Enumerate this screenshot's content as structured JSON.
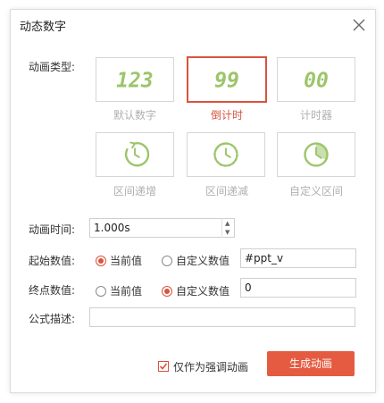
{
  "dialog": {
    "title": "动态数字",
    "animation_type_label": "动画类型:",
    "types": [
      {
        "display": "123",
        "label": "默认数字",
        "selected": false,
        "icon": "digits"
      },
      {
        "display": "99",
        "label": "倒计时",
        "selected": true,
        "icon": "digits"
      },
      {
        "display": "00",
        "label": "计时器",
        "selected": false,
        "icon": "digits"
      },
      {
        "display": "",
        "label": "区间递增",
        "selected": false,
        "icon": "clock-increase-icon"
      },
      {
        "display": "",
        "label": "区间递减",
        "selected": false,
        "icon": "clock-decrease-icon"
      },
      {
        "display": "",
        "label": "自定义区间",
        "selected": false,
        "icon": "clock-custom-icon"
      }
    ],
    "duration": {
      "label": "动画时间:",
      "value": "1.000s"
    },
    "start_value": {
      "label": "起始数值:",
      "option_current": "当前值",
      "option_custom": "自定义数值",
      "selected": "current",
      "input": "#ppt_v"
    },
    "end_value": {
      "label": "终点数值:",
      "option_current": "当前值",
      "option_custom": "自定义数值",
      "selected": "custom",
      "input": "0"
    },
    "formula": {
      "label": "公式描述:",
      "value": ""
    },
    "emphasis_only": {
      "label": "仅作为强调动画",
      "checked": true
    },
    "generate_button": "生成动画"
  },
  "colors": {
    "accent": "#d9533d",
    "button": "#e55b41",
    "digit": "#9cc56a",
    "muted": "#b0b0b0"
  }
}
